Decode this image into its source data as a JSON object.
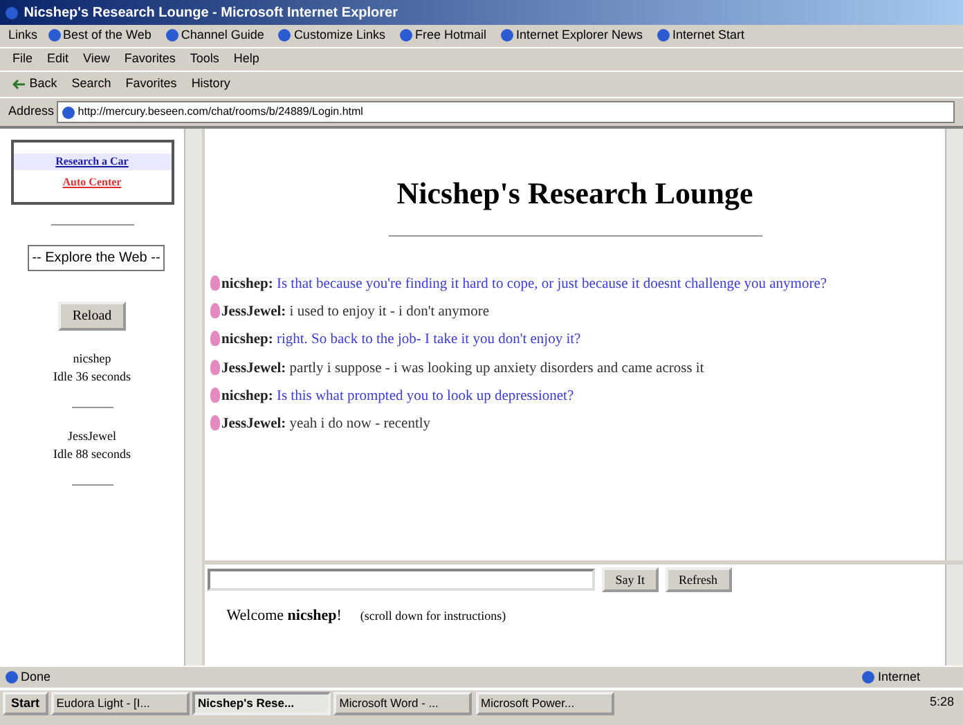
{
  "window": {
    "title": "Nicshep's Research Lounge - Microsoft Internet Explorer"
  },
  "links_bar": {
    "label": "Links",
    "links": [
      "Best of the Web",
      "Channel Guide",
      "Customize Links",
      "Free Hotmail",
      "Internet Explorer News",
      "Internet Start"
    ]
  },
  "menu": [
    "File",
    "Edit",
    "View",
    "Favorites",
    "Tools",
    "Help"
  ],
  "toolbar": {
    "back": "Back",
    "buttons": [
      "Search",
      "Favorites",
      "History"
    ]
  },
  "address_bar": {
    "label": "Address",
    "url": "http://mercury.beseen.com/chat/rooms/b/24889/Login.html"
  },
  "sidebar": {
    "links": [
      {
        "text": "Research a Car",
        "kind": "primary"
      },
      {
        "text": "Auto Center",
        "kind": "secondary"
      }
    ],
    "select": "-- Explore the Web --",
    "reload": "Reload",
    "users": [
      {
        "name": "nicshep",
        "idle": "Idle 36 seconds"
      },
      {
        "name": "JessJewel",
        "idle": "Idle 88 seconds"
      }
    ]
  },
  "chat": {
    "heading": "Nicshep's Research Lounge",
    "messages": [
      {
        "speaker": "nicshep:",
        "text": "Is that because you're finding it hard to cope, or just because it doesnt challenge you anymore?",
        "kind": "host"
      },
      {
        "speaker": "JessJewel:",
        "text": "i used to enjoy it - i don't anymore",
        "kind": "guest"
      },
      {
        "speaker": "nicshep:",
        "text": "right. So back to the job- I take it you don't enjoy it?",
        "kind": "host"
      },
      {
        "speaker": "JessJewel:",
        "text": "partly i suppose - i was looking up anxiety disorders and came across it",
        "kind": "guest"
      },
      {
        "speaker": "nicshep:",
        "text": "Is this what prompted you to look up depressionet?",
        "kind": "host"
      },
      {
        "speaker": "JessJewel:",
        "text": "yeah i do now - recently",
        "kind": "guest"
      }
    ]
  },
  "input_frame": {
    "say": "Say It",
    "refresh": "Refresh",
    "welcome": "Welcome **nicshep**!",
    "hint": "(scroll down for instructions)"
  },
  "status_bar": {
    "status": "Done",
    "zone": "Internet"
  },
  "taskbar": {
    "start": "Start",
    "tasks": [
      {
        "label": "Eudora Light - [I...",
        "selected": false
      },
      {
        "label": "Nicshep's Rese...",
        "selected": true
      },
      {
        "label": "Microsoft Word - ...",
        "selected": false
      },
      {
        "label": "Microsoft Power...",
        "selected": false
      }
    ],
    "clock": "5:28"
  }
}
